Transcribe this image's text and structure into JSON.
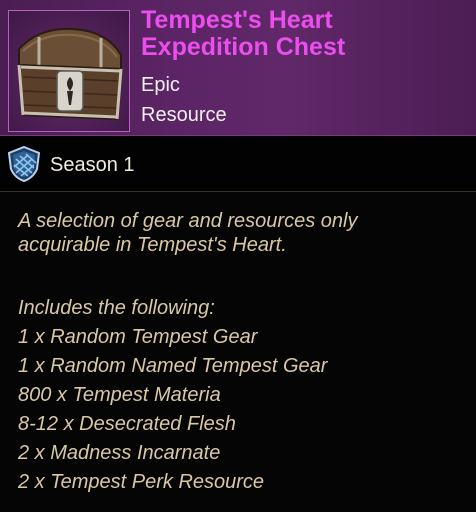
{
  "item": {
    "title_line1": "Tempest's Heart",
    "title_line2": "Expedition Chest",
    "rarity": "Epic",
    "category": "Resource",
    "icon": "treasure-chest",
    "rarity_color": "#ec4dee"
  },
  "season": {
    "label": "Season 1",
    "icon": "season-shield"
  },
  "description": {
    "line1": "A selection of gear and resources only",
    "line2": "acquirable in Tempest's Heart."
  },
  "includes": {
    "heading": "Includes the following:",
    "items": [
      "1 x Random Tempest Gear",
      "1 x Random Named Tempest Gear",
      "800 x Tempest Materia",
      "8-12 x Desecrated Flesh",
      "2 x Madness Incarnate",
      "2 x Tempest Perk Resource"
    ]
  }
}
